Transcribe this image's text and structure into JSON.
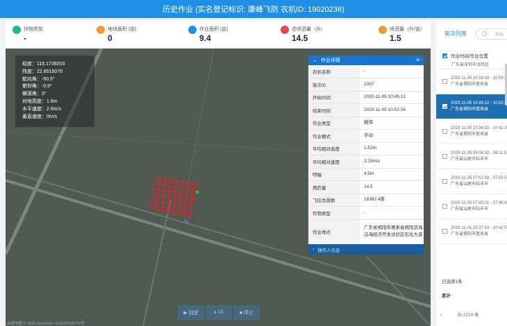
{
  "title": "历史作业 (实名登记标识: 康峰飞防 农机ID: 19020236)",
  "stats": [
    {
      "label": "作物类型",
      "value": "-",
      "icon": "crop-icon",
      "color": "#1fb98a"
    },
    {
      "label": "地块面积 (亩)",
      "value": "0",
      "icon": "field-area-icon",
      "color": "#f29a3b"
    },
    {
      "label": "作业面积 (亩)",
      "value": "9.4",
      "icon": "work-area-icon",
      "color": "#1f8fe6"
    },
    {
      "label": "总喷洒量（升）",
      "value": "14.5",
      "icon": "spray-total-icon",
      "color": "#e8454d"
    },
    {
      "label": "喷洒量（升/亩）",
      "value": "1.5",
      "icon": "spray-rate-icon",
      "color": "#f29a3b"
    }
  ],
  "telemetry": [
    "经度：116.1739203",
    "纬度：22.8515076",
    "航向角：-50.5°",
    "俯仰角：-0.9°",
    "横滚角：3°",
    "对地高度：1.6m",
    "水平速度：2.6m/s",
    "垂直速度：0m/s"
  ],
  "details": {
    "header": "作业详情",
    "rows": [
      {
        "k": "农机名称",
        "v": "-"
      },
      {
        "k": "架次ID",
        "v": "2397"
      },
      {
        "k": "开始时间",
        "v": "2020-11-05 10:45:12"
      },
      {
        "k": "结束时间",
        "v": "2020-11-05 10:52:26"
      },
      {
        "k": "作业类型",
        "v": "植保"
      },
      {
        "k": "作业模式",
        "v": "手动"
      },
      {
        "k": "平均相对高度",
        "v": "1.52m"
      },
      {
        "k": "平均相对速度",
        "v": "3.29m/s"
      },
      {
        "k": "喷幅",
        "v": "4.5m"
      },
      {
        "k": "用药量",
        "v": "14.5"
      },
      {
        "k": "飞控总亩数",
        "v": "18362.4亩"
      },
      {
        "k": "作物类型",
        "v": "-"
      }
    ],
    "location_label": "作业地点",
    "location_value": "广东省揭阳市惠来县揭阳滨海沿海经济开发试验区石化大道",
    "footer": "操作人信息"
  },
  "playback": {
    "play": "▶ 回放",
    "speed": "⏸ 1X",
    "stop": "■ 停止"
  },
  "map_footer": "高德地图 © 2020 AutoNavi - GS(2019)6379号",
  "right_panel": {
    "title": "架次列表",
    "search_placeholder": "开始",
    "list_header": "作业时间/作业位置",
    "partial_top": "广东省深圳市龙岗区",
    "sorties": [
      {
        "time": "2020-11-05 10:58:19 - 10:59:4",
        "place": "广东省揭阳市惠来县",
        "selected": false
      },
      {
        "time": "2020-11-05 10:45:12 - 10:52:2",
        "place": "广东省揭阳市惠来县",
        "selected": true
      },
      {
        "time": "2020-11-05 10:34:33 - 10:42:3",
        "place": "广东省揭阳市惠来县",
        "selected": false
      },
      {
        "time": "2020-11-05 08:04:10 - 08:11:5",
        "place": "广东省汕尾市陆丰市",
        "selected": false
      },
      {
        "time": "2020-11-05 07:51:59 - 07:53:5",
        "place": "广东省汕尾市陆丰市",
        "selected": false
      },
      {
        "time": "2020-11-05 07:45:21 - 07:49:4",
        "place": "广东省汕尾市陆丰市",
        "selected": false
      },
      {
        "time": "2020-11-01 10:37:43 - 10:42:5",
        "place": "广东省揭阳市惠来县",
        "selected": false
      }
    ],
    "selected_count": "已选择1条",
    "total_label": "总计",
    "pager": "共 2214 条"
  }
}
